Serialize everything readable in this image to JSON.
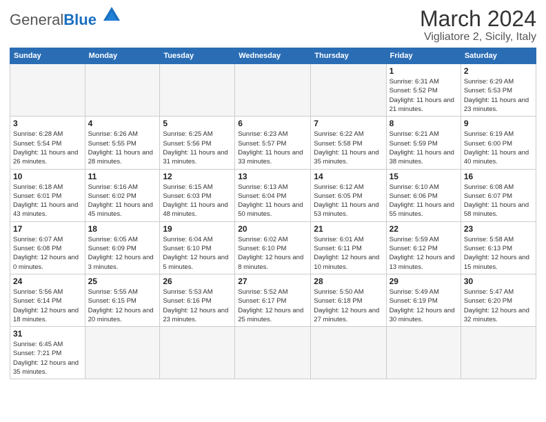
{
  "header": {
    "logo_general": "General",
    "logo_blue": "Blue",
    "month_title": "March 2024",
    "location": "Vigliatore 2, Sicily, Italy"
  },
  "weekdays": [
    "Sunday",
    "Monday",
    "Tuesday",
    "Wednesday",
    "Thursday",
    "Friday",
    "Saturday"
  ],
  "weeks": [
    [
      {
        "day": "",
        "info": ""
      },
      {
        "day": "",
        "info": ""
      },
      {
        "day": "",
        "info": ""
      },
      {
        "day": "",
        "info": ""
      },
      {
        "day": "",
        "info": ""
      },
      {
        "day": "1",
        "info": "Sunrise: 6:31 AM\nSunset: 5:52 PM\nDaylight: 11 hours and 21 minutes."
      },
      {
        "day": "2",
        "info": "Sunrise: 6:29 AM\nSunset: 5:53 PM\nDaylight: 11 hours and 23 minutes."
      }
    ],
    [
      {
        "day": "3",
        "info": "Sunrise: 6:28 AM\nSunset: 5:54 PM\nDaylight: 11 hours and 26 minutes."
      },
      {
        "day": "4",
        "info": "Sunrise: 6:26 AM\nSunset: 5:55 PM\nDaylight: 11 hours and 28 minutes."
      },
      {
        "day": "5",
        "info": "Sunrise: 6:25 AM\nSunset: 5:56 PM\nDaylight: 11 hours and 31 minutes."
      },
      {
        "day": "6",
        "info": "Sunrise: 6:23 AM\nSunset: 5:57 PM\nDaylight: 11 hours and 33 minutes."
      },
      {
        "day": "7",
        "info": "Sunrise: 6:22 AM\nSunset: 5:58 PM\nDaylight: 11 hours and 35 minutes."
      },
      {
        "day": "8",
        "info": "Sunrise: 6:21 AM\nSunset: 5:59 PM\nDaylight: 11 hours and 38 minutes."
      },
      {
        "day": "9",
        "info": "Sunrise: 6:19 AM\nSunset: 6:00 PM\nDaylight: 11 hours and 40 minutes."
      }
    ],
    [
      {
        "day": "10",
        "info": "Sunrise: 6:18 AM\nSunset: 6:01 PM\nDaylight: 11 hours and 43 minutes."
      },
      {
        "day": "11",
        "info": "Sunrise: 6:16 AM\nSunset: 6:02 PM\nDaylight: 11 hours and 45 minutes."
      },
      {
        "day": "12",
        "info": "Sunrise: 6:15 AM\nSunset: 6:03 PM\nDaylight: 11 hours and 48 minutes."
      },
      {
        "day": "13",
        "info": "Sunrise: 6:13 AM\nSunset: 6:04 PM\nDaylight: 11 hours and 50 minutes."
      },
      {
        "day": "14",
        "info": "Sunrise: 6:12 AM\nSunset: 6:05 PM\nDaylight: 11 hours and 53 minutes."
      },
      {
        "day": "15",
        "info": "Sunrise: 6:10 AM\nSunset: 6:06 PM\nDaylight: 11 hours and 55 minutes."
      },
      {
        "day": "16",
        "info": "Sunrise: 6:08 AM\nSunset: 6:07 PM\nDaylight: 11 hours and 58 minutes."
      }
    ],
    [
      {
        "day": "17",
        "info": "Sunrise: 6:07 AM\nSunset: 6:08 PM\nDaylight: 12 hours and 0 minutes."
      },
      {
        "day": "18",
        "info": "Sunrise: 6:05 AM\nSunset: 6:09 PM\nDaylight: 12 hours and 3 minutes."
      },
      {
        "day": "19",
        "info": "Sunrise: 6:04 AM\nSunset: 6:10 PM\nDaylight: 12 hours and 5 minutes."
      },
      {
        "day": "20",
        "info": "Sunrise: 6:02 AM\nSunset: 6:10 PM\nDaylight: 12 hours and 8 minutes."
      },
      {
        "day": "21",
        "info": "Sunrise: 6:01 AM\nSunset: 6:11 PM\nDaylight: 12 hours and 10 minutes."
      },
      {
        "day": "22",
        "info": "Sunrise: 5:59 AM\nSunset: 6:12 PM\nDaylight: 12 hours and 13 minutes."
      },
      {
        "day": "23",
        "info": "Sunrise: 5:58 AM\nSunset: 6:13 PM\nDaylight: 12 hours and 15 minutes."
      }
    ],
    [
      {
        "day": "24",
        "info": "Sunrise: 5:56 AM\nSunset: 6:14 PM\nDaylight: 12 hours and 18 minutes."
      },
      {
        "day": "25",
        "info": "Sunrise: 5:55 AM\nSunset: 6:15 PM\nDaylight: 12 hours and 20 minutes."
      },
      {
        "day": "26",
        "info": "Sunrise: 5:53 AM\nSunset: 6:16 PM\nDaylight: 12 hours and 23 minutes."
      },
      {
        "day": "27",
        "info": "Sunrise: 5:52 AM\nSunset: 6:17 PM\nDaylight: 12 hours and 25 minutes."
      },
      {
        "day": "28",
        "info": "Sunrise: 5:50 AM\nSunset: 6:18 PM\nDaylight: 12 hours and 27 minutes."
      },
      {
        "day": "29",
        "info": "Sunrise: 5:49 AM\nSunset: 6:19 PM\nDaylight: 12 hours and 30 minutes."
      },
      {
        "day": "30",
        "info": "Sunrise: 5:47 AM\nSunset: 6:20 PM\nDaylight: 12 hours and 32 minutes."
      }
    ],
    [
      {
        "day": "31",
        "info": "Sunrise: 6:45 AM\nSunset: 7:21 PM\nDaylight: 12 hours and 35 minutes."
      },
      {
        "day": "",
        "info": ""
      },
      {
        "day": "",
        "info": ""
      },
      {
        "day": "",
        "info": ""
      },
      {
        "day": "",
        "info": ""
      },
      {
        "day": "",
        "info": ""
      },
      {
        "day": "",
        "info": ""
      }
    ]
  ]
}
